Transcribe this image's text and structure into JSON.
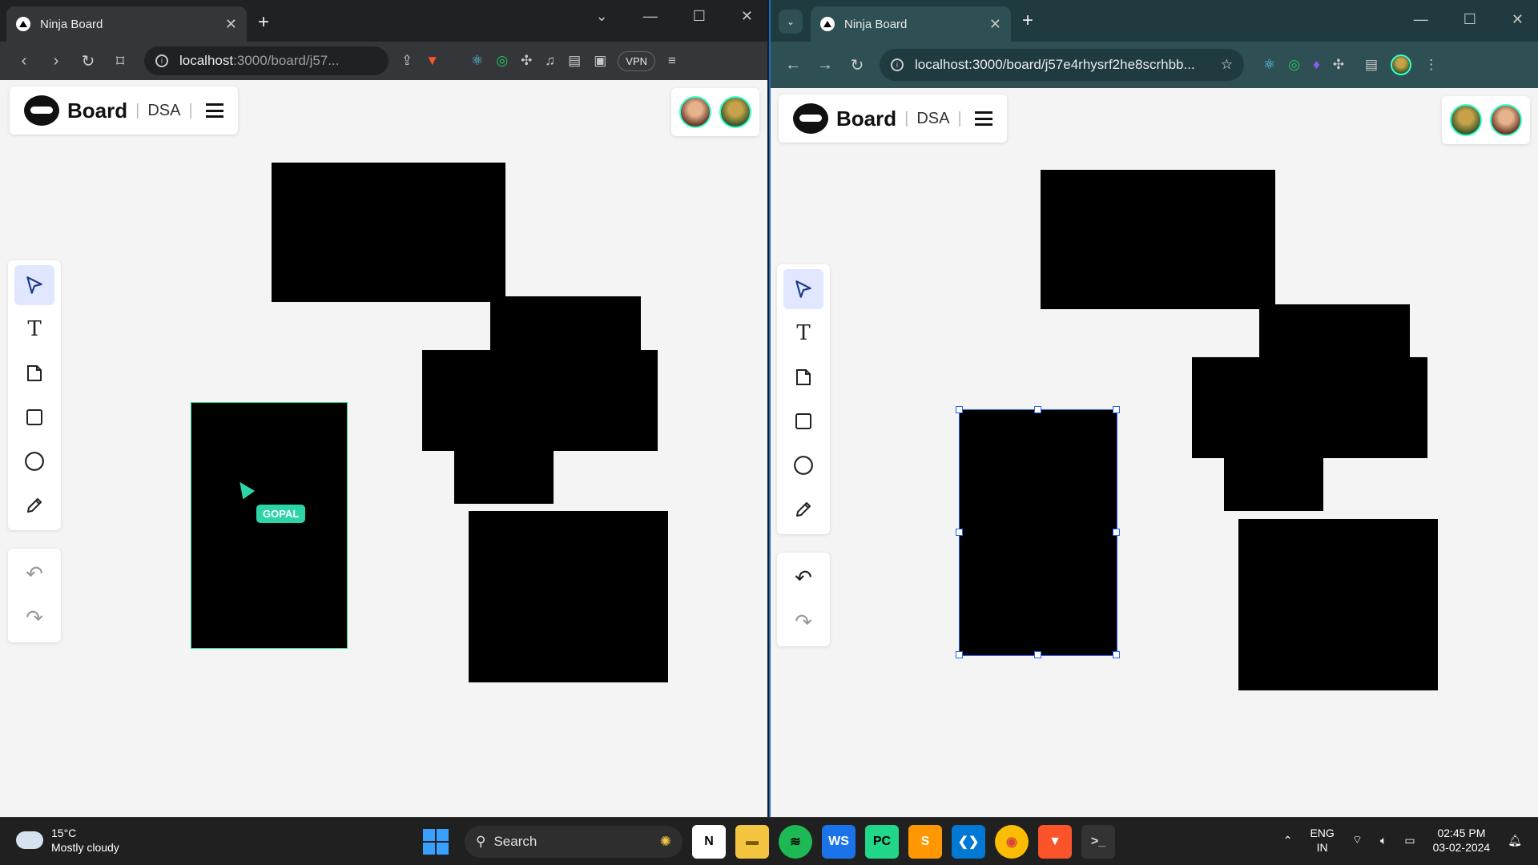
{
  "left_browser": {
    "tab_title": "Ninja Board",
    "url_host": "localhost",
    "url_rest": ":3000/board/j57...",
    "vpn_label": "VPN"
  },
  "right_browser": {
    "tab_title": "Ninja Board",
    "url_host": "localhost",
    "url_rest": ":3000/board/j57e4rhysrf2he8scrhbb..."
  },
  "board": {
    "app_title": "Board",
    "board_name": "DSA",
    "separator": "|"
  },
  "tools": {
    "select": "select-tool",
    "text": "T",
    "note": "note-tool",
    "rectangle": "rectangle-tool",
    "ellipse": "ellipse-tool",
    "pencil": "pencil-tool",
    "undo": "↶",
    "redo": "↷"
  },
  "collaborator_cursor": {
    "name": "GOPAL",
    "color": "#2dd4a7"
  },
  "taskbar": {
    "temperature": "15°C",
    "weather": "Mostly cloudy",
    "search_label": "Search",
    "lang_top": "ENG",
    "lang_bottom": "IN",
    "time": "02:45 PM",
    "date": "03-02-2024"
  },
  "colors": {
    "selection_blue": "#2563eb",
    "accent_teal": "#2dd4a7"
  }
}
